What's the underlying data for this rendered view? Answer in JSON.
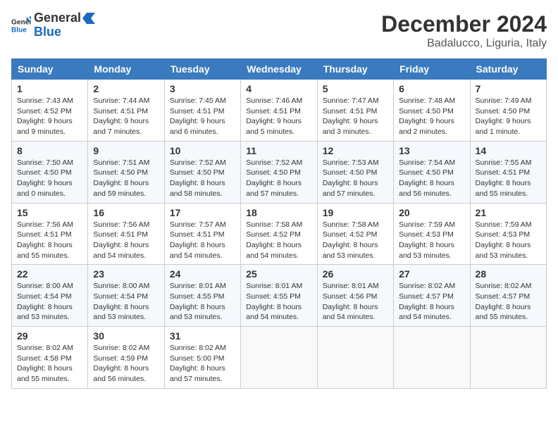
{
  "header": {
    "logo_general": "General",
    "logo_blue": "Blue",
    "month_title": "December 2024",
    "location": "Badalucco, Liguria, Italy"
  },
  "weekdays": [
    "Sunday",
    "Monday",
    "Tuesday",
    "Wednesday",
    "Thursday",
    "Friday",
    "Saturday"
  ],
  "weeks": [
    [
      {
        "day": "1",
        "info": "Sunrise: 7:43 AM\nSunset: 4:52 PM\nDaylight: 9 hours\nand 9 minutes."
      },
      {
        "day": "2",
        "info": "Sunrise: 7:44 AM\nSunset: 4:51 PM\nDaylight: 9 hours\nand 7 minutes."
      },
      {
        "day": "3",
        "info": "Sunrise: 7:45 AM\nSunset: 4:51 PM\nDaylight: 9 hours\nand 6 minutes."
      },
      {
        "day": "4",
        "info": "Sunrise: 7:46 AM\nSunset: 4:51 PM\nDaylight: 9 hours\nand 5 minutes."
      },
      {
        "day": "5",
        "info": "Sunrise: 7:47 AM\nSunset: 4:51 PM\nDaylight: 9 hours\nand 3 minutes."
      },
      {
        "day": "6",
        "info": "Sunrise: 7:48 AM\nSunset: 4:50 PM\nDaylight: 9 hours\nand 2 minutes."
      },
      {
        "day": "7",
        "info": "Sunrise: 7:49 AM\nSunset: 4:50 PM\nDaylight: 9 hours\nand 1 minute."
      }
    ],
    [
      {
        "day": "8",
        "info": "Sunrise: 7:50 AM\nSunset: 4:50 PM\nDaylight: 9 hours\nand 0 minutes."
      },
      {
        "day": "9",
        "info": "Sunrise: 7:51 AM\nSunset: 4:50 PM\nDaylight: 8 hours\nand 59 minutes."
      },
      {
        "day": "10",
        "info": "Sunrise: 7:52 AM\nSunset: 4:50 PM\nDaylight: 8 hours\nand 58 minutes."
      },
      {
        "day": "11",
        "info": "Sunrise: 7:52 AM\nSunset: 4:50 PM\nDaylight: 8 hours\nand 57 minutes."
      },
      {
        "day": "12",
        "info": "Sunrise: 7:53 AM\nSunset: 4:50 PM\nDaylight: 8 hours\nand 57 minutes."
      },
      {
        "day": "13",
        "info": "Sunrise: 7:54 AM\nSunset: 4:50 PM\nDaylight: 8 hours\nand 56 minutes."
      },
      {
        "day": "14",
        "info": "Sunrise: 7:55 AM\nSunset: 4:51 PM\nDaylight: 8 hours\nand 55 minutes."
      }
    ],
    [
      {
        "day": "15",
        "info": "Sunrise: 7:56 AM\nSunset: 4:51 PM\nDaylight: 8 hours\nand 55 minutes."
      },
      {
        "day": "16",
        "info": "Sunrise: 7:56 AM\nSunset: 4:51 PM\nDaylight: 8 hours\nand 54 minutes."
      },
      {
        "day": "17",
        "info": "Sunrise: 7:57 AM\nSunset: 4:51 PM\nDaylight: 8 hours\nand 54 minutes."
      },
      {
        "day": "18",
        "info": "Sunrise: 7:58 AM\nSunset: 4:52 PM\nDaylight: 8 hours\nand 54 minutes."
      },
      {
        "day": "19",
        "info": "Sunrise: 7:58 AM\nSunset: 4:52 PM\nDaylight: 8 hours\nand 53 minutes."
      },
      {
        "day": "20",
        "info": "Sunrise: 7:59 AM\nSunset: 4:53 PM\nDaylight: 8 hours\nand 53 minutes."
      },
      {
        "day": "21",
        "info": "Sunrise: 7:59 AM\nSunset: 4:53 PM\nDaylight: 8 hours\nand 53 minutes."
      }
    ],
    [
      {
        "day": "22",
        "info": "Sunrise: 8:00 AM\nSunset: 4:54 PM\nDaylight: 8 hours\nand 53 minutes."
      },
      {
        "day": "23",
        "info": "Sunrise: 8:00 AM\nSunset: 4:54 PM\nDaylight: 8 hours\nand 53 minutes."
      },
      {
        "day": "24",
        "info": "Sunrise: 8:01 AM\nSunset: 4:55 PM\nDaylight: 8 hours\nand 53 minutes."
      },
      {
        "day": "25",
        "info": "Sunrise: 8:01 AM\nSunset: 4:55 PM\nDaylight: 8 hours\nand 54 minutes."
      },
      {
        "day": "26",
        "info": "Sunrise: 8:01 AM\nSunset: 4:56 PM\nDaylight: 8 hours\nand 54 minutes."
      },
      {
        "day": "27",
        "info": "Sunrise: 8:02 AM\nSunset: 4:57 PM\nDaylight: 8 hours\nand 54 minutes."
      },
      {
        "day": "28",
        "info": "Sunrise: 8:02 AM\nSunset: 4:57 PM\nDaylight: 8 hours\nand 55 minutes."
      }
    ],
    [
      {
        "day": "29",
        "info": "Sunrise: 8:02 AM\nSunset: 4:58 PM\nDaylight: 8 hours\nand 55 minutes."
      },
      {
        "day": "30",
        "info": "Sunrise: 8:02 AM\nSunset: 4:59 PM\nDaylight: 8 hours\nand 56 minutes."
      },
      {
        "day": "31",
        "info": "Sunrise: 8:02 AM\nSunset: 5:00 PM\nDaylight: 8 hours\nand 57 minutes."
      },
      {
        "day": "",
        "info": ""
      },
      {
        "day": "",
        "info": ""
      },
      {
        "day": "",
        "info": ""
      },
      {
        "day": "",
        "info": ""
      }
    ]
  ]
}
